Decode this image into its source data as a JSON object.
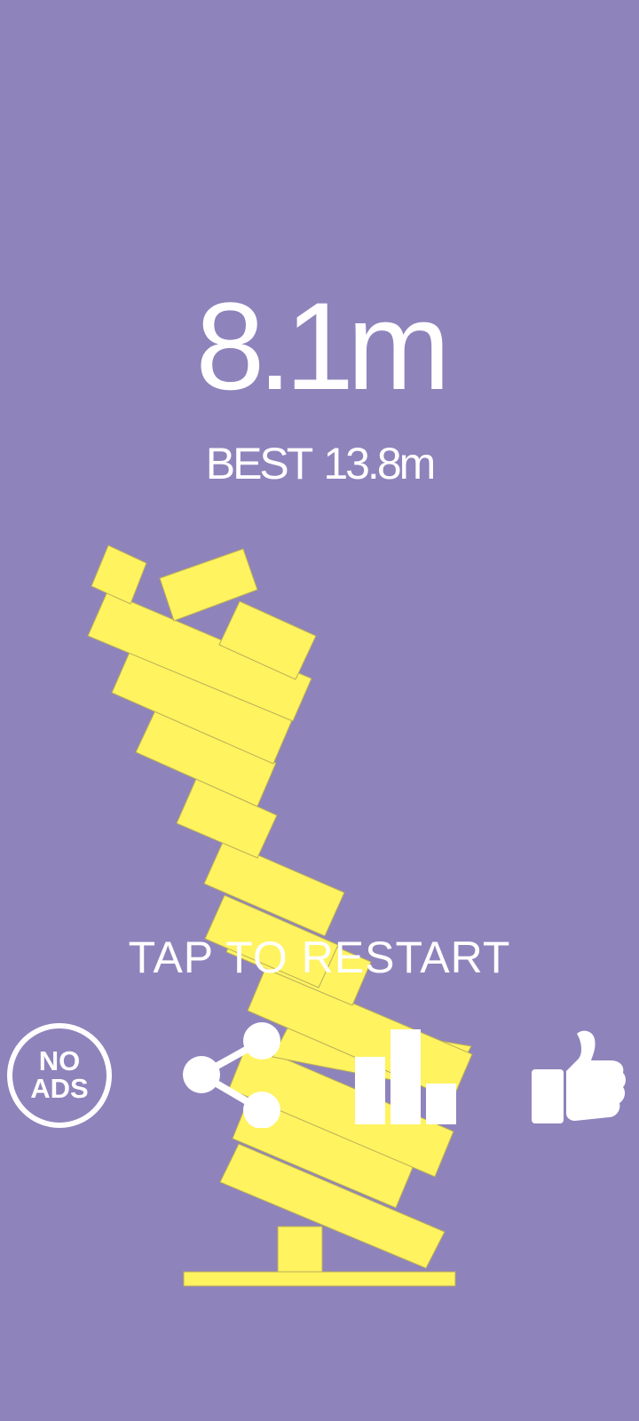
{
  "theme": {
    "background": "#8F83BC",
    "block": "#FFF35F",
    "text": "#FFFFFF"
  },
  "score": {
    "current_value": "8.1m",
    "best_label": "BEST",
    "best_value": "13.8m"
  },
  "prompt": {
    "restart": "TAP TO RESTART"
  },
  "buttons": {
    "no_ads_line1": "NO",
    "no_ads_line2": "ADS",
    "share_icon": "share-icon",
    "leaderboard_icon": "leaderboard-icon",
    "rate_icon": "thumbs-up-icon"
  },
  "game": {
    "stacked_blocks": 18
  }
}
